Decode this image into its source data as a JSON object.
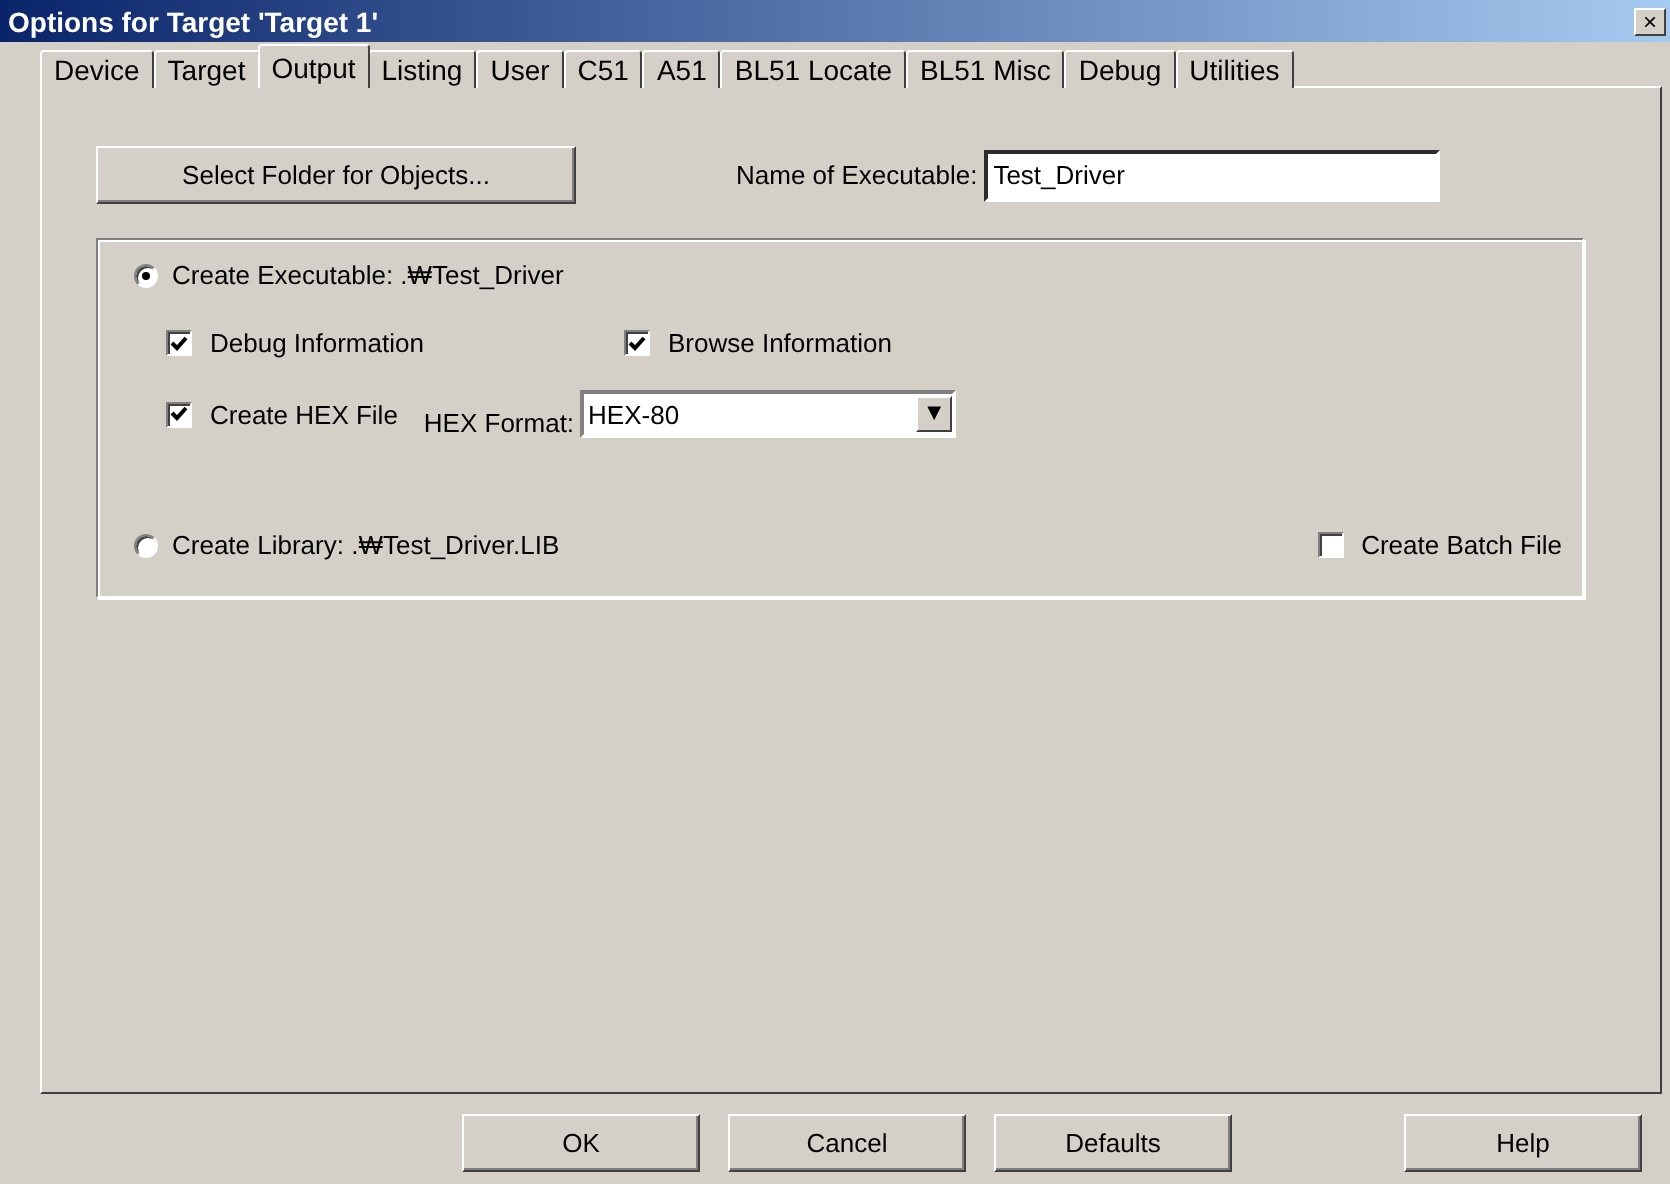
{
  "window": {
    "title": "Options for Target 'Target 1'",
    "close": "×"
  },
  "tabs": [
    {
      "label": "Device",
      "selected": false
    },
    {
      "label": "Target",
      "selected": false
    },
    {
      "label": "Output",
      "selected": true
    },
    {
      "label": "Listing",
      "selected": false
    },
    {
      "label": "User",
      "selected": false
    },
    {
      "label": "C51",
      "selected": false
    },
    {
      "label": "A51",
      "selected": false
    },
    {
      "label": "BL51 Locate",
      "selected": false
    },
    {
      "label": "BL51 Misc",
      "selected": false
    },
    {
      "label": "Debug",
      "selected": false
    },
    {
      "label": "Utilities",
      "selected": false
    }
  ],
  "select_folder_button": "Select Folder for Objects...",
  "name_of_executable": {
    "label": "Name of Executable:",
    "value": "Test_Driver"
  },
  "create_executable": {
    "label": "Create Executable:  .₩Test_Driver",
    "selected": true
  },
  "debug_information": {
    "label": "Debug Information",
    "checked": true
  },
  "browse_information": {
    "label": "Browse Information",
    "checked": true
  },
  "create_hex_file": {
    "label": "Create HEX File",
    "checked": true
  },
  "hex_format": {
    "label": "HEX Format:",
    "value": "HEX-80",
    "arrow": "▼"
  },
  "create_library": {
    "label": "Create Library:  .₩Test_Driver.LIB",
    "selected": false
  },
  "create_batch_file": {
    "label": "Create Batch File",
    "checked": false
  },
  "buttons": [
    "OK",
    "Cancel",
    "Defaults",
    "Help"
  ]
}
